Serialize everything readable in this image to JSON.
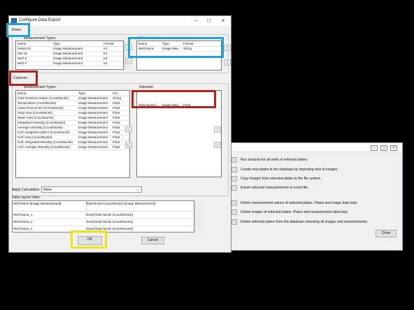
{
  "dialog": {
    "title": "Configure Data Export",
    "rows_label": "Rows:",
    "columns_label": "Columns:",
    "rows_available_label": "Measurement Types:",
    "columns_available_label": "Measurement Types:",
    "selected_label": "Selected:",
    "apply_calc_label": "Apply Calculation:",
    "apply_calc_value": "None",
    "layout_label": "Data Layout View:",
    "ok": "OK",
    "cancel": "Cancel"
  },
  "rows_list": {
    "headers": [
      "Name",
      "Type",
      "Format"
    ],
    "items": [
      [
        "Series ID",
        "Image Measurement",
        "Int"
      ],
      [
        "Site ID",
        "Image Measurement",
        "Int"
      ],
      [
        "Well X",
        "Image Measurement",
        "Int"
      ],
      [
        "Well Y",
        "Image Measurement",
        "Int"
      ]
    ]
  },
  "rows_selected": {
    "headers": [
      "Name",
      "Type",
      "Format"
    ],
    "items": [
      [
        "Well Name",
        "Image Mea...",
        "String"
      ]
    ]
  },
  "columns_list": {
    "headers": [
      "Name",
      "Type",
      "For..."
    ],
    "items": [
      [
        "CO2 Pressure Status (CountNuclei)",
        "Image Measurement",
        "String"
      ],
      [
        "Temperature (CountNuclei)",
        "Image Measurement",
        "Float"
      ],
      [
        "Laser focus score (CountNuclei)",
        "Image Measurement",
        "Float"
      ],
      [
        "Total Area (CountNuclei)",
        "Image Measurement",
        "Float"
      ],
      [
        "Mean Area (CountNuclei)",
        "Image Measurement",
        "Float"
      ],
      [
        "Integrated Intensity (CountNuclei)",
        "Image Measurement",
        "Float"
      ],
      [
        "Average Intensity (CountNuclei)",
        "Image Measurement",
        "Float"
      ],
      [
        "Cell: Assigned Label # (CountNuclei)",
        "Image Measurement",
        "Float"
      ],
      [
        "Cell: Area (CountNuclei)",
        "Image Measurement",
        "Float"
      ],
      [
        "Cell: Integrated Intensity (CountNuclei)",
        "Image Measurement",
        "Float"
      ],
      [
        "Cell: Average Intensity (CountNuclei)",
        "Image Measurement",
        "Float"
      ]
    ]
  },
  "columns_selected": {
    "items": [
      [
        "Total Nuclei (...",
        "Image Mea...",
        "Float"
      ]
    ]
  },
  "layout_table": {
    "headers": [
      "Well Name [Image Measurement]",
      "Total Nuclei (CountNuclei) [Image Measurement]"
    ],
    "rows": [
      [
        "Well Name_1",
        "None(Total Nuclei (CountNuclei))"
      ],
      [
        "Well Name_2",
        "None(Total Nuclei (CountNuclei))"
      ],
      [
        "Well Name_n",
        "None(Total Nuclei (CountNuclei))"
      ]
    ]
  },
  "background_window": {
    "ops": [
      "Run analysis for all wells of selected plates.",
      "Create new plates in the database by importing sets of images.",
      "Copy images from selected plates to the file system.",
      "Export selected measurements to a text file.",
      "Delete measurement values of selected plates. Plates and image data kept.",
      "Delete images of selected plates. Plates and measurement data kept.",
      "Delete selected plates from the database removing all images and measurements."
    ],
    "close": "Close"
  },
  "colors": {
    "highlight_blue": "#1ea3d8",
    "highlight_red": "#b3241a",
    "highlight_yellow": "#f0e30f"
  }
}
